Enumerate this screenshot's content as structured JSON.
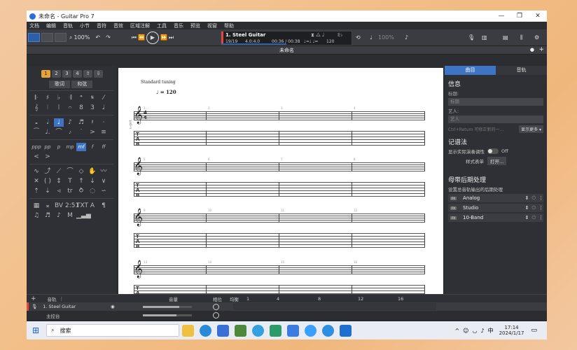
{
  "window": {
    "title": "未命名 - Guitar Pro 7",
    "min": "—",
    "max": "❐",
    "close": "✕"
  },
  "menu": [
    "文档",
    "编辑",
    "音轨",
    "小节",
    "音符",
    "音效",
    "区域注解",
    "工具",
    "音乐",
    "预览",
    "视窗",
    "帮助"
  ],
  "toolbar": {
    "zoom": "100%",
    "undo": "↶",
    "redo": "↷",
    "speed": "100%",
    "tuning_box": "E♭"
  },
  "track_display": {
    "name": "1. Steel Guitar",
    "bar": "19/19",
    "sig": "4.0:4.0",
    "time": "00:36 / 00:38",
    "notes": "♩=♩ ♩=",
    "tempo": "120"
  },
  "doc_tab": "未命名",
  "left_panel": {
    "btn_lyrics": "歌词",
    "btn_chord": "和弦",
    "voices": [
      "1",
      "2",
      "3",
      "4"
    ]
  },
  "score": {
    "tuning": "Standard tuning",
    "tempo": "= 120",
    "time_top": "4",
    "time_bot": "4",
    "track_label": "s.-guit.",
    "systems": [
      {
        "measures": [
          "1",
          "2",
          "3",
          "4"
        ]
      },
      {
        "measures": [
          "5",
          "6",
          "7",
          "8"
        ]
      },
      {
        "measures": [
          "9",
          "10",
          "11",
          "12"
        ]
      },
      {
        "measures": [
          "13",
          "14",
          "15",
          "16"
        ]
      }
    ]
  },
  "right_panel": {
    "tabs": [
      "曲目",
      "音轨"
    ],
    "info_title": "信息",
    "title_label": "标题:",
    "title_ph": "标题",
    "artist_label": "艺人:",
    "artist_ph": "艺人",
    "hint": "Ctrl+Return 可修正新的一...",
    "more": "显示更多 ▾",
    "notation_title": "记谱法",
    "tuning_toggle_label": "显示实际演奏调性",
    "tuning_toggle_state": "Off",
    "stylesheet": "样式表单",
    "open": "打开...",
    "master_title": "母带后期处理",
    "master_desc": "设置总音轨输出的后期处理",
    "fx": [
      "Analog",
      "Studio",
      "10-Band"
    ]
  },
  "tracks": {
    "header": "音轨",
    "volume": "音量",
    "pan": "相位",
    "eq": "均衡",
    "ruler": [
      "1",
      "4",
      "8",
      "12",
      "16"
    ],
    "track1": "1. Steel Guitar",
    "master": "主控台"
  },
  "taskbar": {
    "search": "搜索",
    "ime": "中",
    "time": "17:14",
    "date": "2024/1/17"
  },
  "colors": {
    "accent": "#2d5fa8",
    "tab_active": "#3d74c4",
    "voice": "#e8a23a",
    "track_red": "#e8453c"
  }
}
